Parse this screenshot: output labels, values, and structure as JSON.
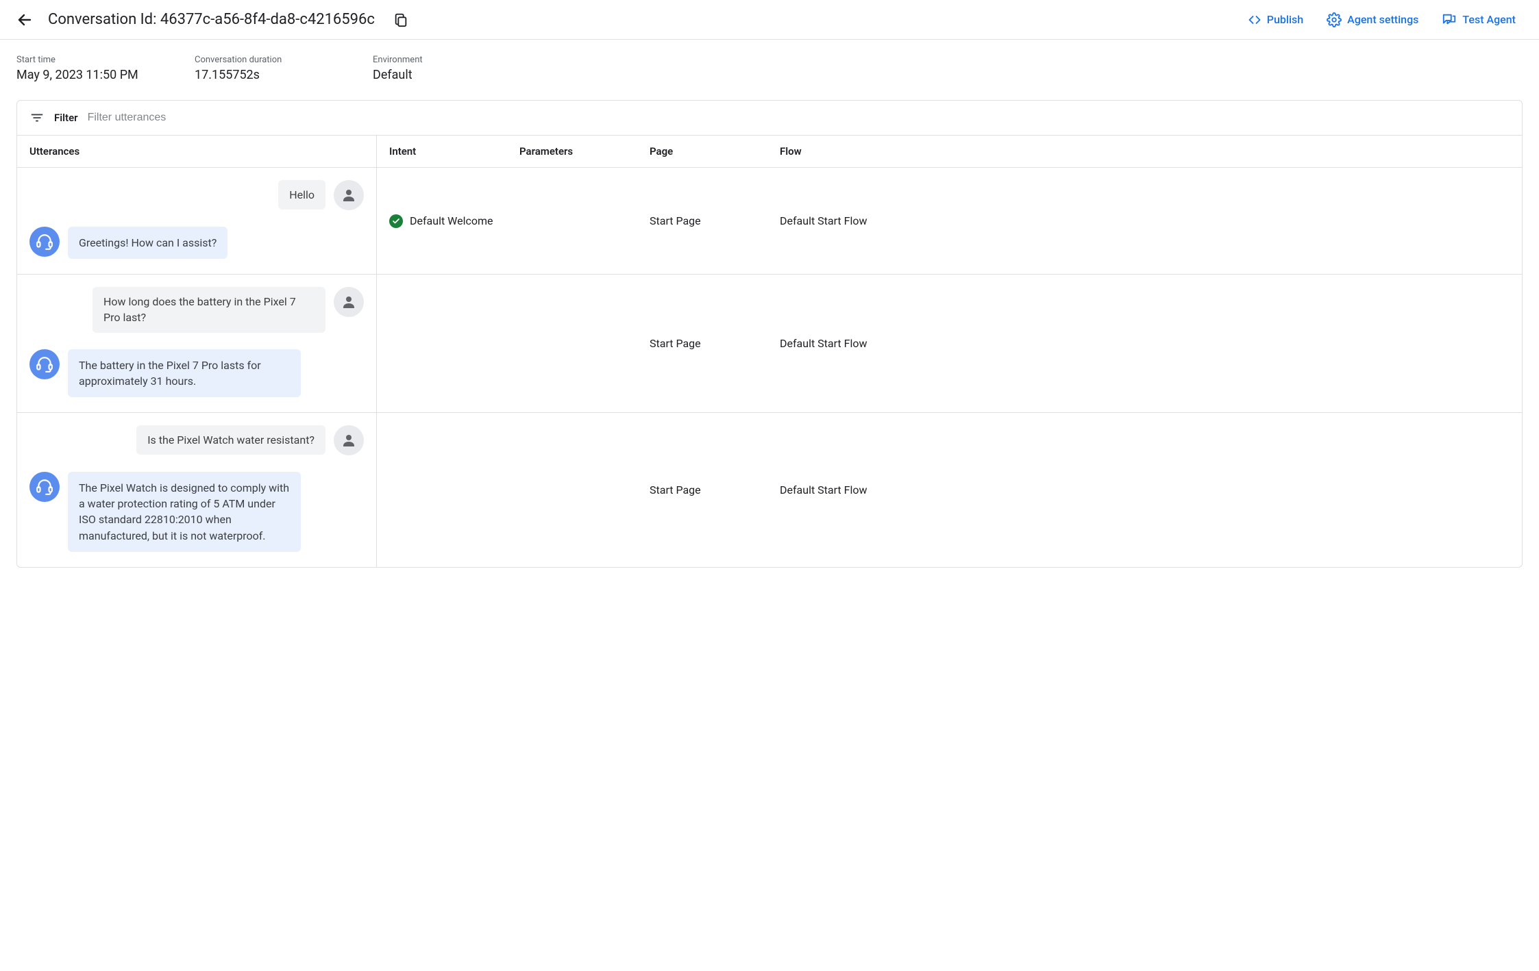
{
  "header": {
    "title": "Conversation Id: 46377c-a56-8f4-da8-c4216596c",
    "actions": {
      "publish": "Publish",
      "agent_settings": "Agent settings",
      "test_agent": "Test Agent"
    }
  },
  "meta": {
    "start_time_label": "Start time",
    "start_time_value": "May 9, 2023 11:50 PM",
    "duration_label": "Conversation duration",
    "duration_value": "17.155752s",
    "environment_label": "Environment",
    "environment_value": "Default"
  },
  "filter": {
    "label": "Filter",
    "placeholder": "Filter utterances"
  },
  "columns": {
    "utterances": "Utterances",
    "intent": "Intent",
    "parameters": "Parameters",
    "page": "Page",
    "flow": "Flow"
  },
  "turns": [
    {
      "user": "Hello",
      "agent": "Greetings! How can I assist?",
      "intent": "Default Welcome",
      "intent_matched": true,
      "parameters": "",
      "page": "Start Page",
      "flow": "Default Start Flow"
    },
    {
      "user": "How long does the battery in the Pixel 7 Pro last?",
      "agent": "The battery in the Pixel 7 Pro lasts for approximately 31 hours.",
      "intent": "",
      "intent_matched": false,
      "parameters": "",
      "page": "Start Page",
      "flow": "Default Start Flow"
    },
    {
      "user": "Is the Pixel Watch water resistant?",
      "agent": "The Pixel Watch is designed to comply with a water protection rating of 5 ATM under ISO standard 22810:2010 when manufactured, but it is not waterproof.",
      "intent": "",
      "intent_matched": false,
      "parameters": "",
      "page": "Start Page",
      "flow": "Default Start Flow"
    }
  ]
}
